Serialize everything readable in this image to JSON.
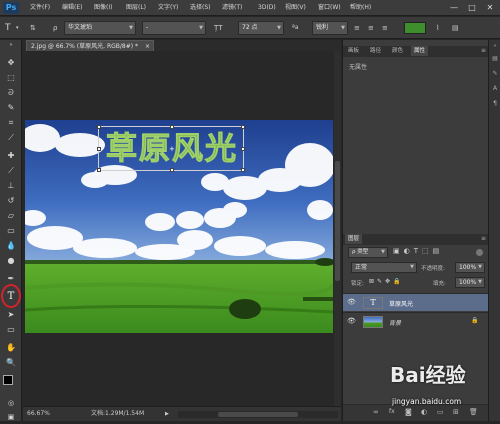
{
  "app": {
    "logo": "Ps"
  },
  "menu": [
    "文件(F)",
    "编辑(E)",
    "图像(I)",
    "图层(L)",
    "文字(Y)",
    "选择(S)",
    "滤镜(T)",
    "3D(D)",
    "视图(V)",
    "窗口(W)",
    "帮助(H)"
  ],
  "window_controls": {
    "minimize": "—",
    "restore": "□",
    "close": "✕"
  },
  "options": {
    "font_family": "华文琥珀",
    "font_style": "-",
    "font_size": "72 点",
    "aa_label": "ªa",
    "antialias": "锐利",
    "color": "#3e8e2e"
  },
  "document": {
    "tab_title": "2.jpg @ 66.7% (草原风光, RGB/8#) *",
    "tab_close": "×",
    "text_layer_text": "草原风光",
    "text_color": "#4a8f1f",
    "zoom": "66.67%",
    "doc_info": "文档:1.29M/1.54M",
    "status_arrow": "▶"
  },
  "properties_panel": {
    "tabs": [
      "画板",
      "路径",
      "颜色",
      "属性"
    ],
    "active_tab": "属性",
    "content": "无属性"
  },
  "layers_panel": {
    "title": "图层",
    "filter": "ρ 类型",
    "blend_mode": "正常",
    "opacity_label": "不透明度:",
    "opacity": "100%",
    "lock_label": "锁定:",
    "fill_label": "填充:",
    "fill": "100%",
    "layers": [
      {
        "name": "草原风光",
        "type": "text",
        "selected": true
      },
      {
        "name": "背景",
        "type": "image",
        "selected": false,
        "locked": true
      }
    ],
    "footer_icons": [
      "link-icon",
      "fx-icon",
      "mask-icon",
      "adjust-icon",
      "folder-icon",
      "new-layer-icon",
      "trash-icon"
    ]
  },
  "watermark": {
    "text": "Bai经验",
    "url": "jingyan.baidu.com"
  }
}
